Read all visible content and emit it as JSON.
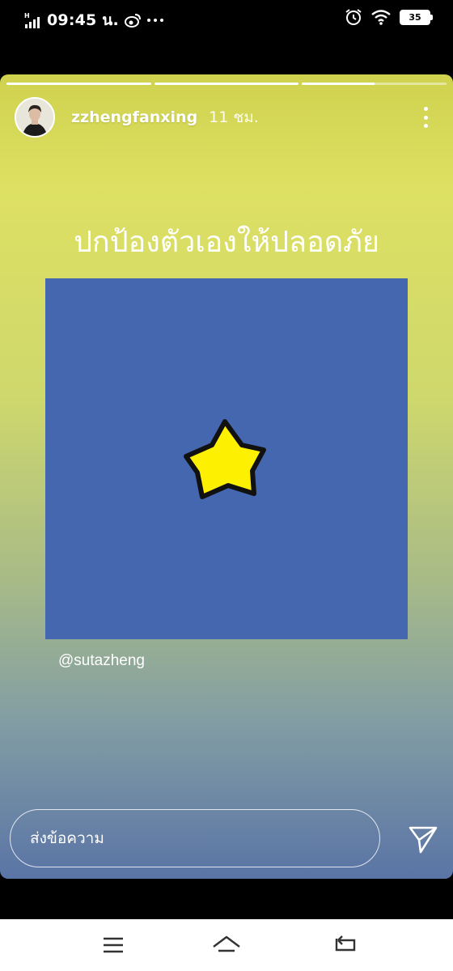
{
  "status_bar": {
    "signal_label": "H",
    "time": "09:45 น.",
    "notification_icons": [
      "weibo-icon",
      "more-notifications-icon"
    ],
    "right_icons": [
      "alarm-icon",
      "wifi-icon"
    ],
    "battery_level": "35"
  },
  "story": {
    "progress_segments": [
      1,
      1,
      0.5
    ],
    "username": "zzhengfanxing",
    "time_ago": "11 ชม.",
    "caption": "ปกป้องตัวเองให้ปลอดภัย",
    "image": {
      "background_color": "#4567b0",
      "sticker": "star-sticker",
      "star_color": "#fdf000"
    },
    "mention": "@sutazheng"
  },
  "reply": {
    "placeholder": "ส่งข้อความ",
    "send_icon": "send-icon"
  },
  "nav_bar": {
    "buttons": [
      "menu-icon",
      "home-icon",
      "back-icon"
    ]
  }
}
